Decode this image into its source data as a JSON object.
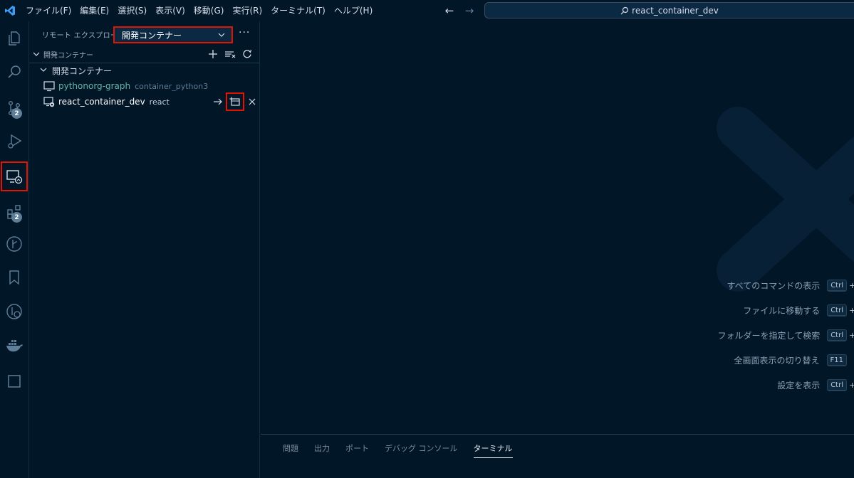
{
  "titlebar": {
    "menu": [
      "ファイル(F)",
      "編集(E)",
      "選択(S)",
      "表示(V)",
      "移動(G)",
      "実行(R)",
      "ターミナル(T)",
      "ヘルプ(H)"
    ],
    "search_text": "react_container_dev"
  },
  "activitybar": {
    "scm_badge": "2",
    "extensions_badge": "2"
  },
  "sidebar": {
    "title": "リモート エクスプローラー",
    "remote_select": "開発コンテナー",
    "more": "···",
    "section_title": "開発コンテナー",
    "group_label": "開発コンテナー",
    "items": [
      {
        "name": "pythonorg-graph",
        "desc": "container_python3"
      },
      {
        "name": "react_container_dev",
        "desc": "react"
      }
    ]
  },
  "editor": {
    "shortcuts": [
      {
        "label": "すべてのコマンドの表示",
        "key": "Ctrl",
        "plus": "+"
      },
      {
        "label": "ファイルに移動する",
        "key": "Ctrl",
        "plus": "+"
      },
      {
        "label": "フォルダーを指定して検索",
        "key": "Ctrl",
        "plus": "+"
      },
      {
        "label": "全画面表示の切り替え",
        "key": "F11",
        "plus": ""
      },
      {
        "label": "設定を表示",
        "key": "Ctrl",
        "plus": "+"
      }
    ]
  },
  "panel": {
    "tabs": [
      "問題",
      "出力",
      "ポート",
      "デバッグ コンソール",
      "ターミナル"
    ],
    "active_tab": "ターミナル"
  },
  "colors": {
    "background": "#011627",
    "highlight": "#e51400",
    "vscode_blue": "#3c9df5"
  }
}
